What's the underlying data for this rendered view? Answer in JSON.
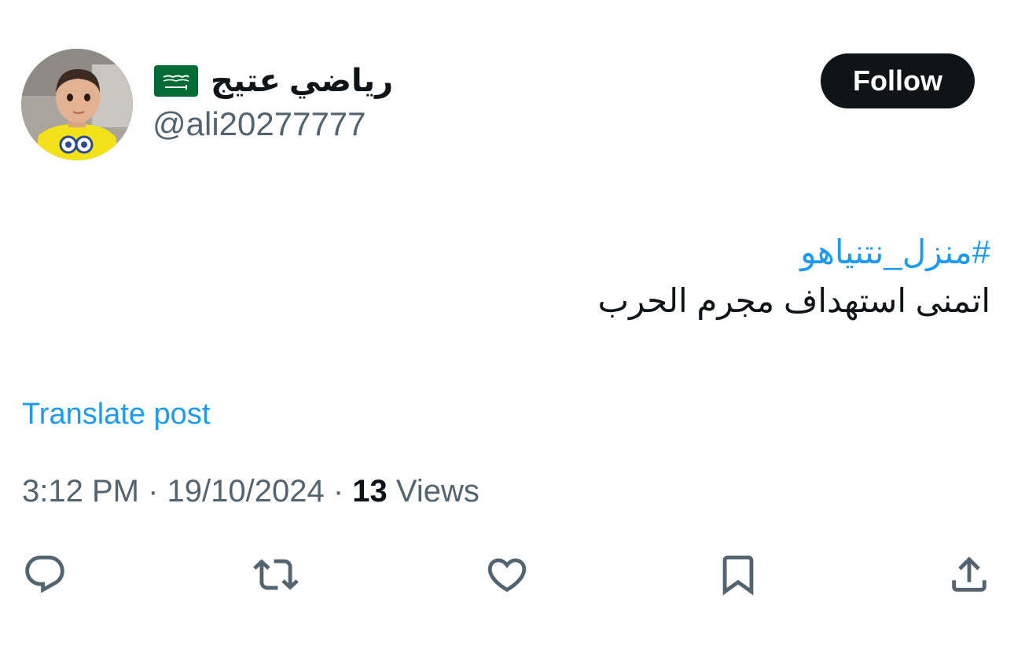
{
  "author": {
    "display_name": "رياضي عتيج",
    "handle": "@ali20277777",
    "flag_icon": "saudi-arabia-flag-icon"
  },
  "follow_label": "Follow",
  "tweet": {
    "hashtag": "#منزل_نتنياهو",
    "text": "اتمنى استهداف مجرم الحرب"
  },
  "translate_label": "Translate post",
  "meta": {
    "time": "3:12 PM",
    "sep1": " · ",
    "date": "19/10/2024",
    "sep2": " · ",
    "views_count": "13",
    "views_label": " Views"
  },
  "actions": [
    {
      "name": "reply",
      "icon": "reply-icon"
    },
    {
      "name": "repost",
      "icon": "repost-icon"
    },
    {
      "name": "like",
      "icon": "heart-icon"
    },
    {
      "name": "bookmark",
      "icon": "bookmark-icon"
    },
    {
      "name": "share",
      "icon": "share-icon"
    }
  ],
  "colors": {
    "accent": "#1d9bf0",
    "text": "#0f1419",
    "secondary": "#536471",
    "flag_green": "#006c35"
  }
}
